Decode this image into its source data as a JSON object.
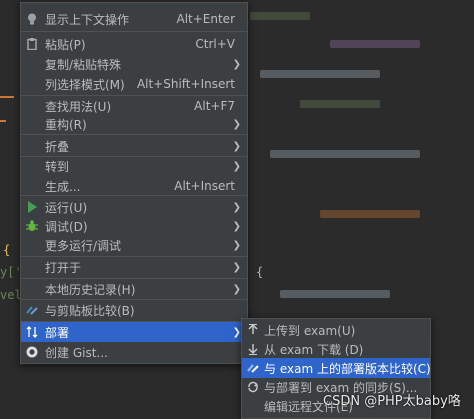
{
  "editor": {
    "fragment_brace_left": "{",
    "fragment_bracket": "y['",
    "fragment_vel": "vel",
    "fragment_brace_right": "{"
  },
  "context_menu": {
    "items": [
      {
        "label": "显示上下文操作",
        "shortcut": "Alt+Enter",
        "icon": "bulb-icon"
      },
      {
        "label": "粘贴(P)",
        "shortcut": "Ctrl+V",
        "icon": "clipboard-icon"
      },
      {
        "label": "复制/粘贴特殊",
        "shortcut": "",
        "icon": ""
      },
      {
        "label": "列选择模式(M)",
        "shortcut": "Alt+Shift+Insert",
        "icon": ""
      },
      {
        "label": "查找用法(U)",
        "shortcut": "Alt+F7",
        "icon": ""
      },
      {
        "label": "重构(R)",
        "shortcut": "",
        "icon": ""
      },
      {
        "label": "折叠",
        "shortcut": "",
        "icon": ""
      },
      {
        "label": "转到",
        "shortcut": "",
        "icon": ""
      },
      {
        "label": "生成...",
        "shortcut": "Alt+Insert",
        "icon": ""
      },
      {
        "label": "运行(U)",
        "shortcut": "",
        "icon": "run-icon"
      },
      {
        "label": "调试(D)",
        "shortcut": "",
        "icon": "debug-icon"
      },
      {
        "label": "更多运行/调试",
        "shortcut": "",
        "icon": ""
      },
      {
        "label": "打开于",
        "shortcut": "",
        "icon": ""
      },
      {
        "label": "本地历史记录(H)",
        "shortcut": "",
        "icon": ""
      },
      {
        "label": "与剪贴板比较(B)",
        "shortcut": "",
        "icon": "compare-icon"
      },
      {
        "label": "部署",
        "shortcut": "",
        "icon": "deploy-icon"
      },
      {
        "label": "创建 Gist...",
        "shortcut": "",
        "icon": "github-icon"
      }
    ]
  },
  "deploy_submenu": {
    "items": [
      {
        "label": "上传到 exam(U)",
        "icon": "upload-icon"
      },
      {
        "label": "从 exam 下载 (D)",
        "icon": "download-icon"
      },
      {
        "label": "与 exam 上的部署版本比较(C)",
        "icon": "compare-icon"
      },
      {
        "label": "与部署到 exam 的同步(S)...",
        "icon": "sync-icon"
      },
      {
        "label": "编辑远程文件(E)",
        "icon": ""
      }
    ]
  },
  "watermark": "CSDN @PHP太baby咯",
  "colors": {
    "menu_bg": "#3c3f41",
    "highlight": "#2f65ca",
    "text": "#bbbbbb",
    "run_green": "#499c54",
    "debug_green": "#62b543"
  }
}
